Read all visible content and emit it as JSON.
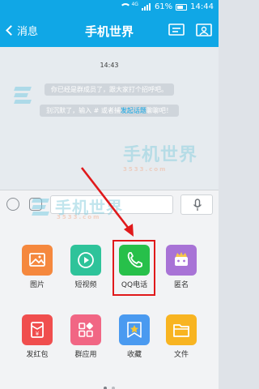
{
  "status_bar": {
    "battery_text": "61%",
    "time": "14:44",
    "network": "4G"
  },
  "nav": {
    "back_label": "消息",
    "title": "手机世界"
  },
  "chat": {
    "time": "14:43",
    "system_message_1": "你已经是群成员了，跟大家打个招呼吧。",
    "system_message_2_prefix": "别沉默了，输入 # 或者捕",
    "system_message_2_link": "发起话题",
    "system_message_2_suffix": "聊聊吧！"
  },
  "watermark": {
    "text": "手机世界",
    "sub": "3533.com"
  },
  "panel": {
    "items": [
      {
        "label": "图片",
        "color": "#f5883e",
        "icon": "image-icon"
      },
      {
        "label": "短视频",
        "color": "#2ec39a",
        "icon": "video-play-icon"
      },
      {
        "label": "QQ电话",
        "color": "#27c04a",
        "icon": "phone-icon"
      },
      {
        "label": "匿名",
        "color": "#a873d6",
        "icon": "anonymous-mask-icon"
      },
      {
        "label": "发红包",
        "color": "#f04e4e",
        "icon": "red-envelope-icon"
      },
      {
        "label": "群应用",
        "color": "#f16684",
        "icon": "apps-grid-icon"
      },
      {
        "label": "收藏",
        "color": "#4a9af0",
        "icon": "favorite-star-icon"
      },
      {
        "label": "文件",
        "color": "#f8b421",
        "icon": "folder-icon"
      }
    ]
  },
  "colors": {
    "accent": "#10a7e6",
    "highlight": "#e0191b",
    "arrow": "#e0191b"
  }
}
